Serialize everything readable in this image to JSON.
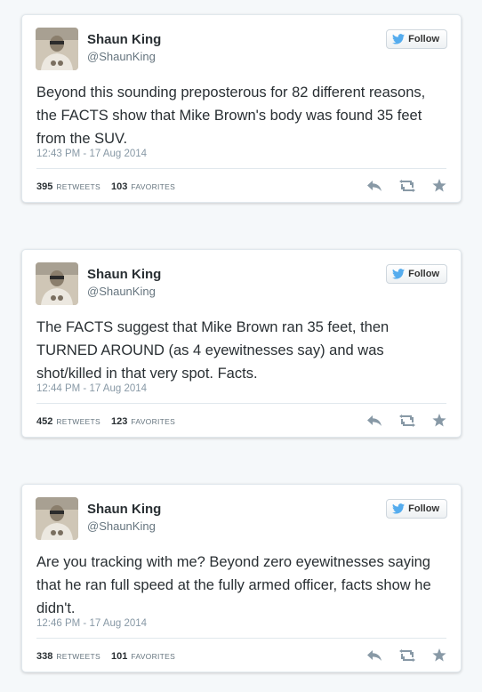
{
  "follow_label": "Follow",
  "retweets_label": "RETWEETS",
  "favorites_label": "FAVORITES",
  "tweets": [
    {
      "name": "Shaun King",
      "handle": "@ShaunKing",
      "text": "Beyond this sounding preposterous for 82 different reasons, the FACTS show that Mike Brown's body was found 35 feet from the SUV.",
      "timestamp": "12:43 PM - 17 Aug 2014",
      "retweets": "395",
      "favorites": "103"
    },
    {
      "name": "Shaun King",
      "handle": "@ShaunKing",
      "text": "The FACTS suggest that Mike Brown ran 35 feet, then TURNED AROUND (as 4 eyewitnesses say) and was shot/killed in that very spot. Facts.",
      "timestamp": "12:44 PM - 17 Aug 2014",
      "retweets": "452",
      "favorites": "123"
    },
    {
      "name": "Shaun King",
      "handle": "@ShaunKing",
      "text": "Are you tracking with me? Beyond zero eyewitnesses saying that he ran full speed at the fully armed officer, facts show he didn't.",
      "timestamp": "12:46 PM - 17 Aug 2014",
      "retweets": "338",
      "favorites": "101"
    }
  ],
  "colors": {
    "bird": "#55acee",
    "action_icon": "#8899a6"
  },
  "icons": [
    "twitter-bird-icon",
    "reply-icon",
    "retweet-icon",
    "favorite-star-icon"
  ]
}
